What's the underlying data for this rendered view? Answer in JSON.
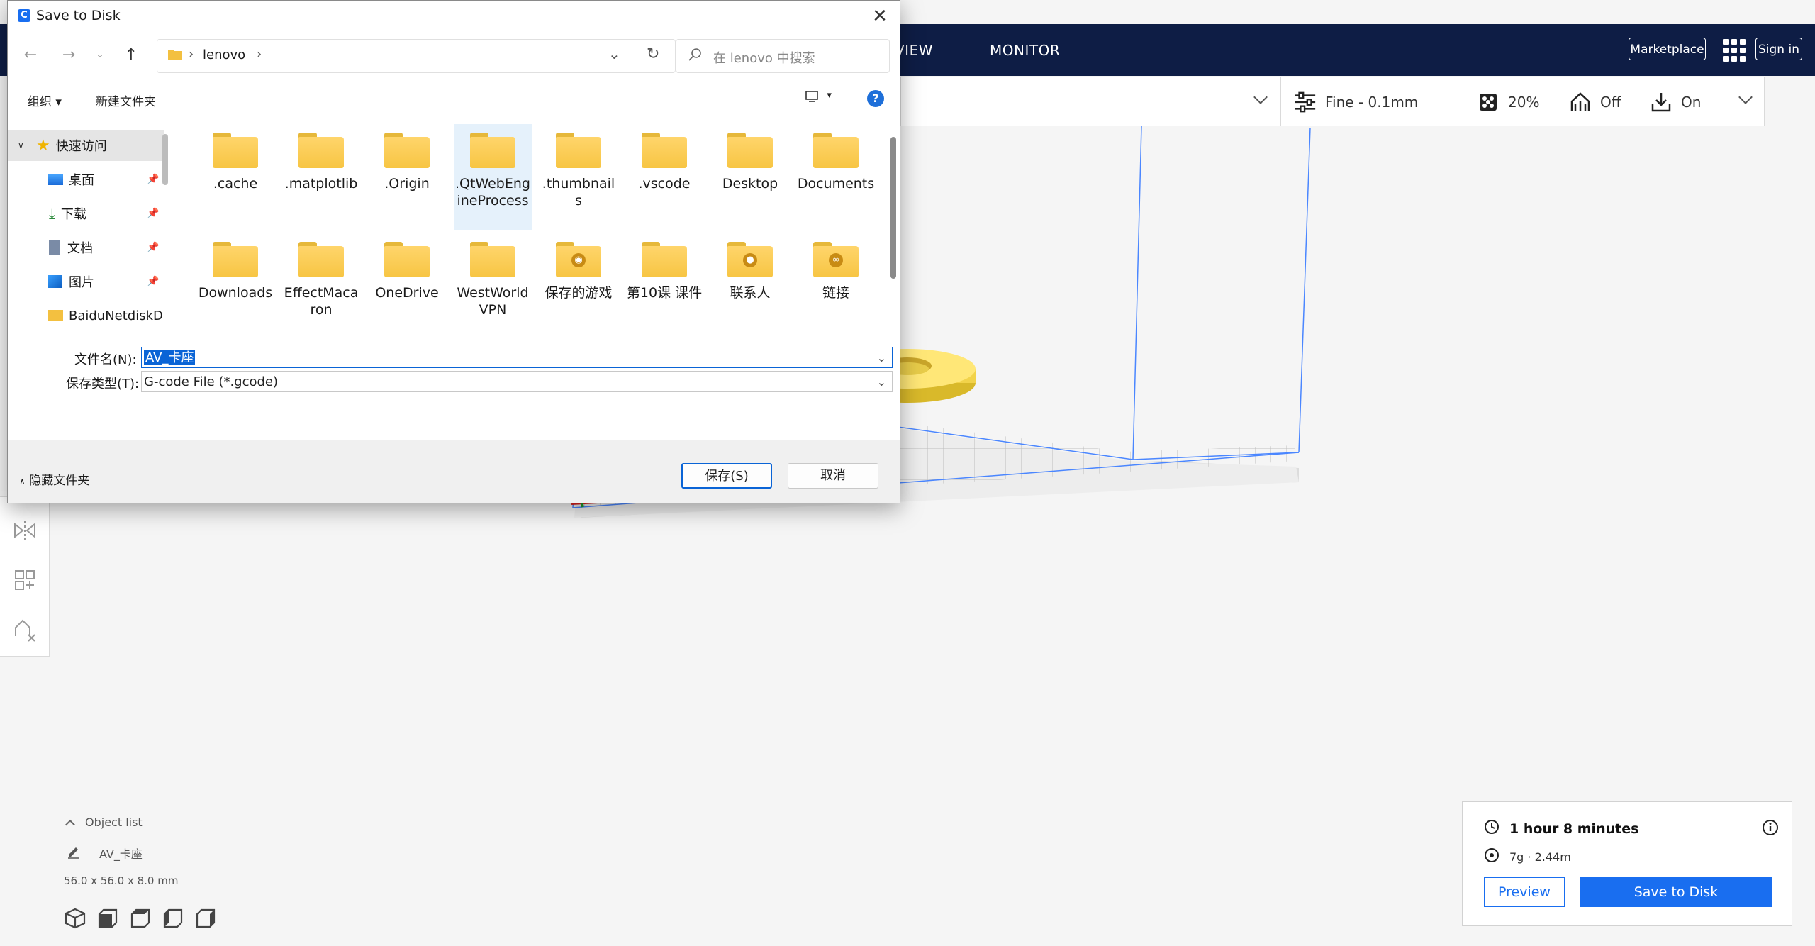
{
  "app": {
    "stage_tabs": [
      "VIEW",
      "MONITOR"
    ],
    "marketplace_label": "Marketplace",
    "signin_label": "Sign in",
    "print_settings": {
      "profile": "Fine - 0.1mm",
      "infill": "20%",
      "support": "Off",
      "adhesion": "On"
    },
    "object_list": {
      "header": "Object list",
      "object_name": "AV_卡座",
      "dimensions": "56.0 x 56.0 x 8.0 mm"
    },
    "job": {
      "time": "1 hour 8 minutes",
      "material": "7g · 2.44m",
      "preview_label": "Preview",
      "save_label": "Save to Disk"
    },
    "colors": {
      "header_bg": "#0e1d45",
      "accent": "#196ef0",
      "model": "#ffe066"
    }
  },
  "dialog": {
    "title": "Save to Disk",
    "path": [
      "lenovo"
    ],
    "search_placeholder": "在 lenovo 中搜索",
    "organize_label": "组织",
    "new_folder_label": "新建文件夹",
    "nav_items": [
      {
        "label": "快速访问",
        "icon": "star-icon"
      },
      {
        "label": "桌面",
        "icon": "desktop-icon"
      },
      {
        "label": "下载",
        "icon": "download-icon"
      },
      {
        "label": "文档",
        "icon": "document-icon"
      },
      {
        "label": "图片",
        "icon": "picture-icon"
      },
      {
        "label": "BaiduNetdiskD",
        "icon": "folder-icon"
      }
    ],
    "files": [
      {
        "name": ".cache"
      },
      {
        "name": ".matplotlib"
      },
      {
        "name": ".Origin"
      },
      {
        "name": ".QtWebEngineProcess"
      },
      {
        "name": ".thumbnails"
      },
      {
        "name": ".vscode"
      },
      {
        "name": "Desktop"
      },
      {
        "name": "Documents"
      },
      {
        "name": "Downloads"
      },
      {
        "name": "EffectMacaron"
      },
      {
        "name": "OneDrive"
      },
      {
        "name": "WestWorldVPN"
      },
      {
        "name": "保存的游戏"
      },
      {
        "name": "第10课 课件"
      },
      {
        "name": "联系人"
      },
      {
        "name": "链接"
      }
    ],
    "filename_label": "文件名(N):",
    "filename_value": "AV_卡座",
    "filetype_label": "保存类型(T):",
    "filetype_value": "G-code File (*.gcode)",
    "hide_folders_label": "隐藏文件夹",
    "save_label": "保存(S)",
    "cancel_label": "取消"
  }
}
